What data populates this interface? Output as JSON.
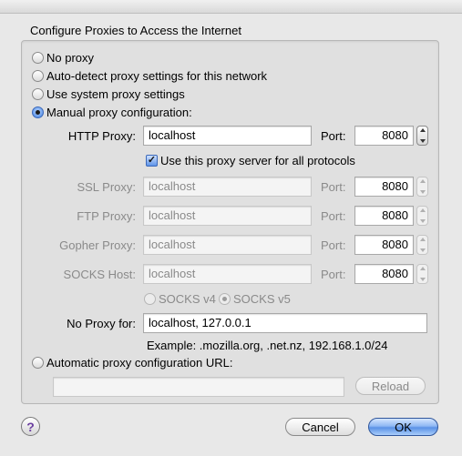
{
  "dialog": {
    "heading": "Configure Proxies to Access the Internet"
  },
  "modes": {
    "no_proxy": "No proxy",
    "auto_detect": "Auto-detect proxy settings for this network",
    "system": "Use system proxy settings",
    "manual": "Manual proxy configuration:",
    "auto_url": "Automatic proxy configuration URL:",
    "selected": "manual"
  },
  "manual": {
    "http": {
      "label": "HTTP Proxy:",
      "host": "localhost",
      "port_label": "Port:",
      "port": "8080"
    },
    "same_for_all": {
      "label": "Use this proxy server for all protocols",
      "checked": true
    },
    "ssl": {
      "label": "SSL Proxy:",
      "host": "localhost",
      "port_label": "Port:",
      "port": "8080"
    },
    "ftp": {
      "label": "FTP Proxy:",
      "host": "localhost",
      "port_label": "Port:",
      "port": "8080"
    },
    "gopher": {
      "label": "Gopher Proxy:",
      "host": "localhost",
      "port_label": "Port:",
      "port": "8080"
    },
    "socks": {
      "label": "SOCKS Host:",
      "host": "localhost",
      "port_label": "Port:",
      "port": "8080"
    },
    "socks_v4": "SOCKS v4",
    "socks_v5": "SOCKS v5",
    "socks_selected": "v5"
  },
  "no_proxy": {
    "label": "No Proxy for:",
    "value": "localhost, 127.0.0.1",
    "example": "Example: .mozilla.org, .net.nz, 192.168.1.0/24"
  },
  "auto_url": {
    "value": "",
    "reload_label": "Reload"
  },
  "footer": {
    "help_glyph": "?",
    "cancel_label": "Cancel",
    "ok_label": "OK"
  },
  "colors": {
    "accent": "#5a92e6",
    "disabled_text": "#8a8a8a",
    "background": "#e8e8e8"
  }
}
